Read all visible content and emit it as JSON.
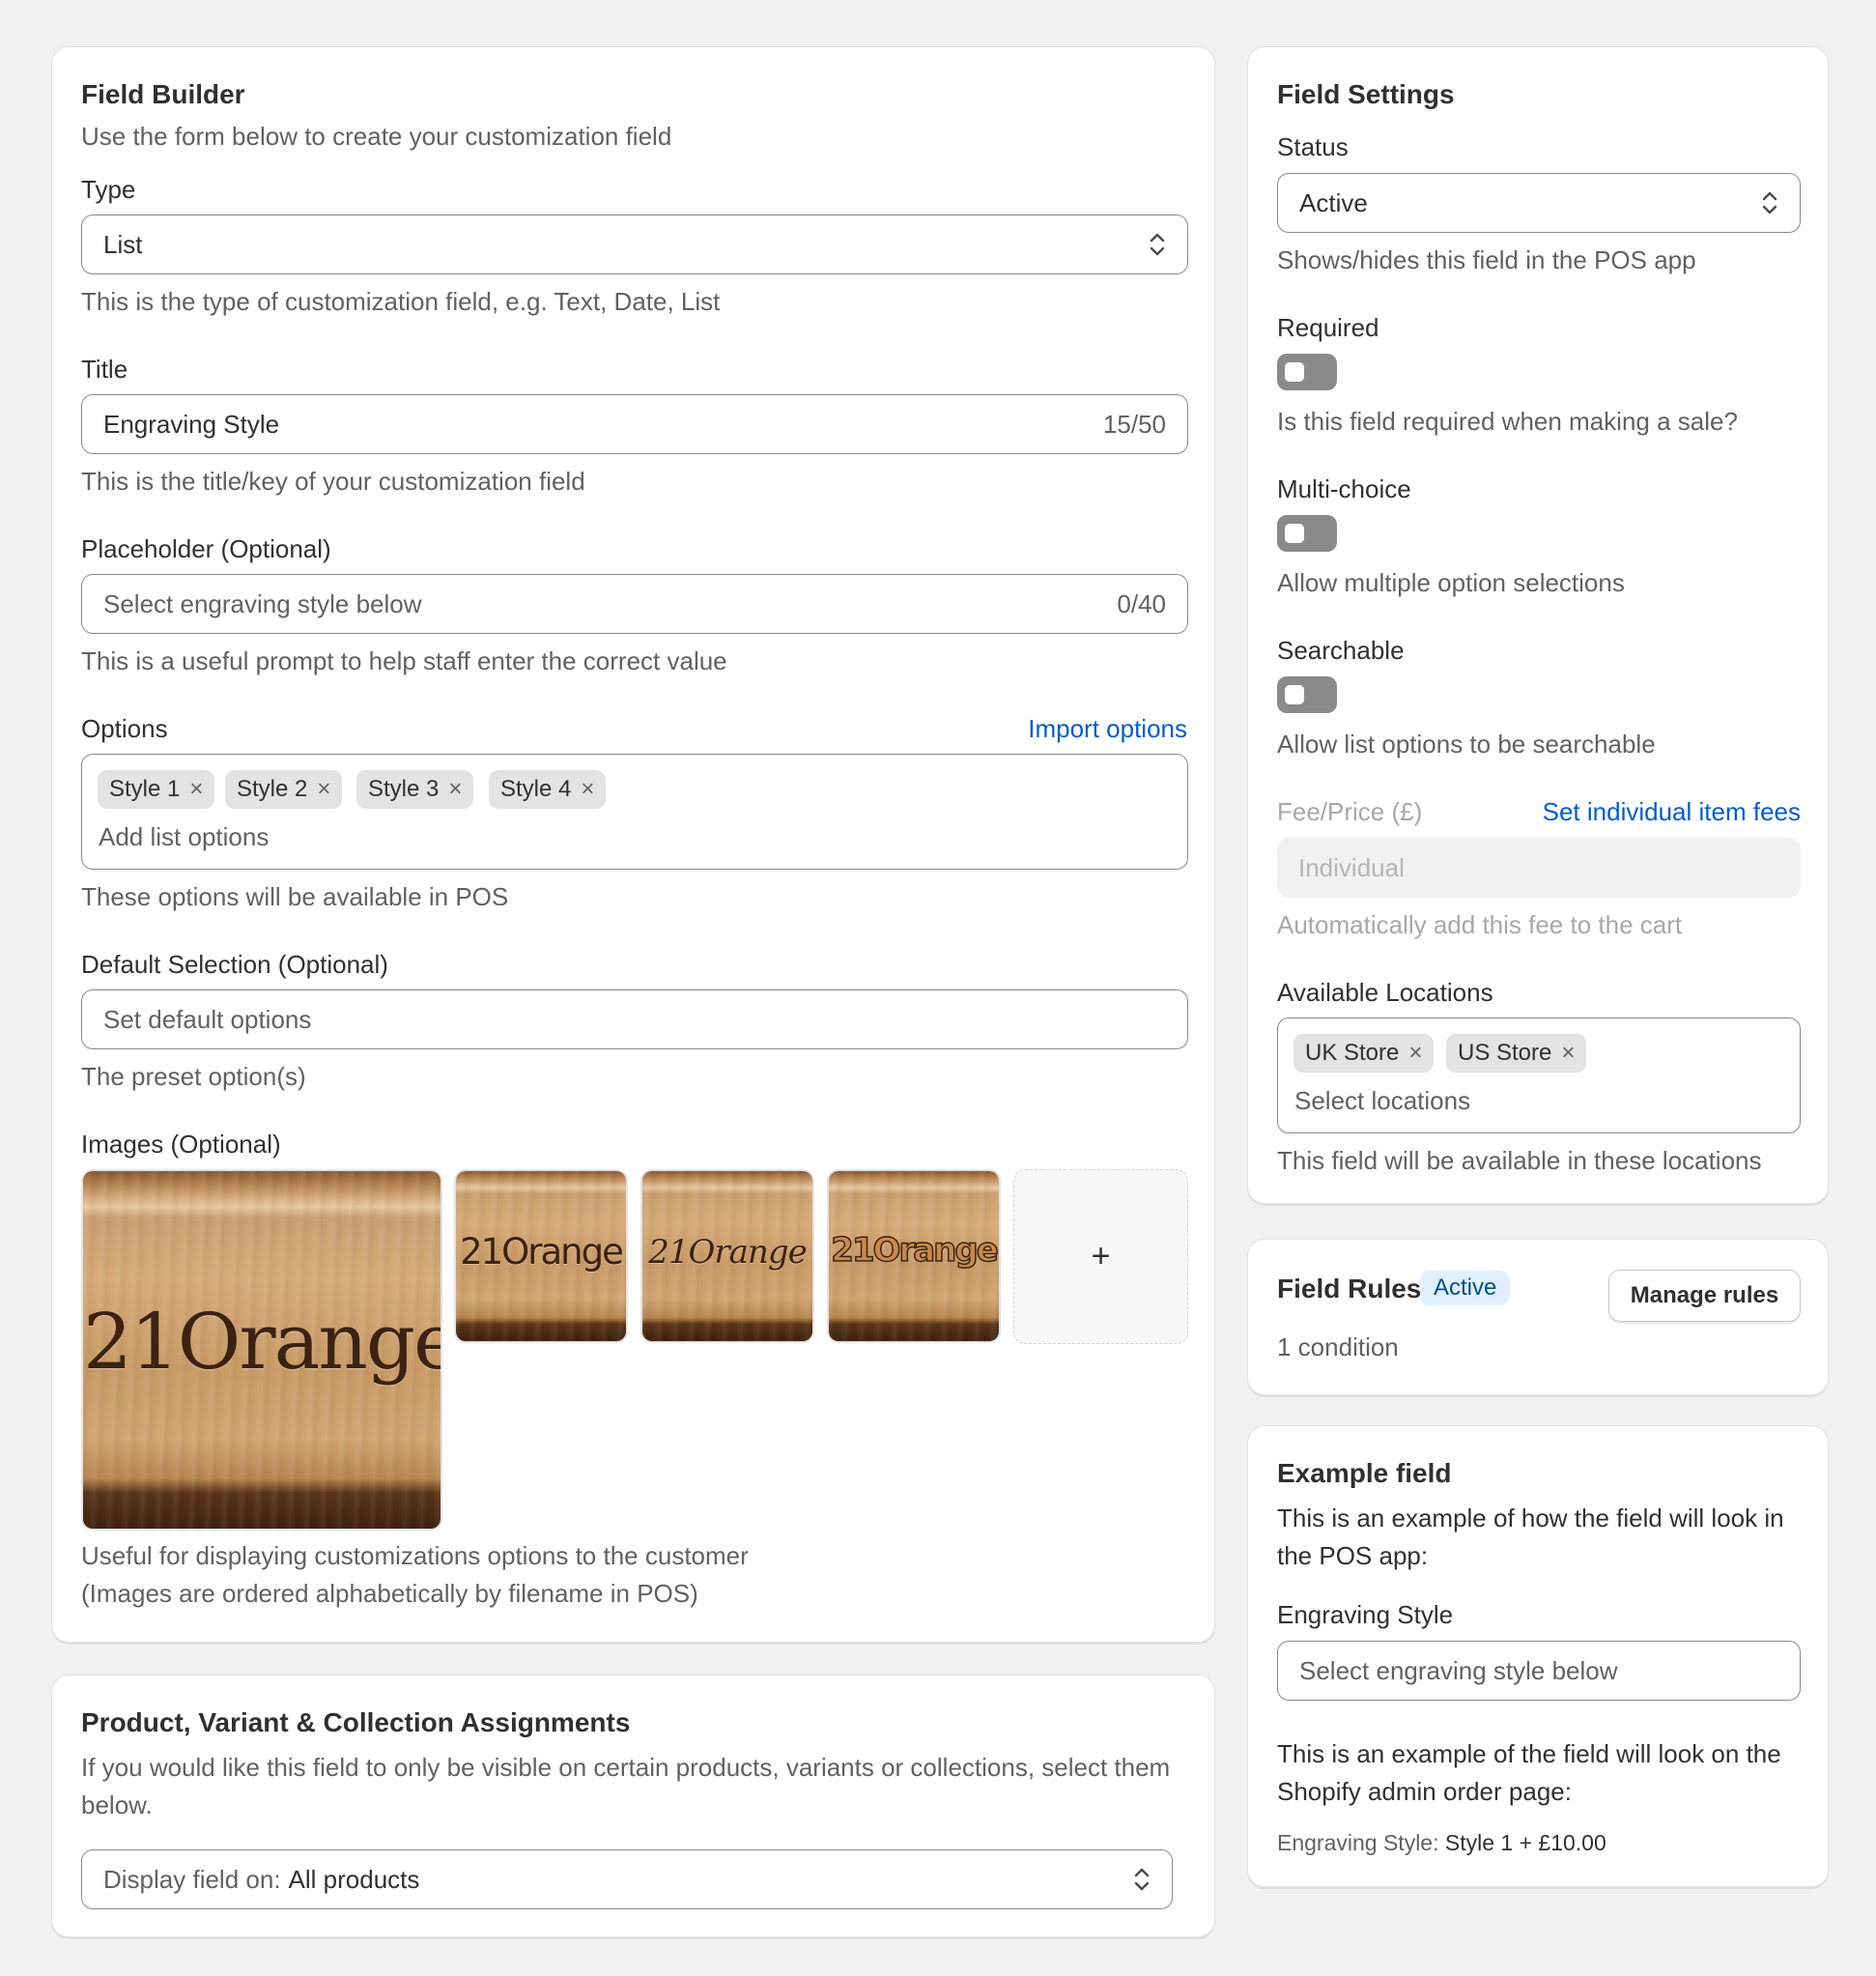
{
  "field_builder": {
    "title": "Field Builder",
    "subtitle": "Use the form below to create your customization field",
    "type": {
      "label": "Type",
      "value": "List",
      "help": "This is the type of customization field, e.g. Text, Date, List"
    },
    "title_field": {
      "label": "Title",
      "value": "Engraving Style",
      "counter": "15/50",
      "help": "This is the title/key of your customization field"
    },
    "placeholder": {
      "label": "Placeholder (Optional)",
      "placeholder": "Select engraving style below",
      "counter": "0/40",
      "help": "This is a useful prompt to help staff enter the correct value"
    },
    "options": {
      "label": "Options",
      "import_link": "Import options",
      "tags": [
        "Style 1",
        "Style 2",
        "Style 3",
        "Style 4"
      ],
      "remove_glyph": "×",
      "placeholder": "Add list options",
      "help": "These options will be available in POS"
    },
    "default_selection": {
      "label": "Default Selection (Optional)",
      "placeholder": "Set default options",
      "help": "The preset option(s)"
    },
    "images": {
      "label": "Images (Optional)",
      "thumbnails": [
        "21Orange",
        "21Orange",
        "21Orange",
        "21Orange"
      ],
      "add_glyph": "+",
      "help_line1": "Useful for displaying customizations options to the customer",
      "help_line2": "(Images are ordered alphabetically by filename in POS)"
    }
  },
  "assignments": {
    "title": "Product, Variant & Collection Assignments",
    "description": "If you would like this field to only be visible on certain products, variants or collections, select them below.",
    "display_prefix": "Display field on:",
    "display_value": "All products"
  },
  "field_settings": {
    "title": "Field Settings",
    "status": {
      "label": "Status",
      "value": "Active",
      "help": "Shows/hides this field in the POS app"
    },
    "required": {
      "label": "Required",
      "on": false,
      "help": "Is this field required when making a sale?"
    },
    "multi_choice": {
      "label": "Multi-choice",
      "on": false,
      "help": "Allow multiple option selections"
    },
    "searchable": {
      "label": "Searchable",
      "on": false,
      "help": "Allow list options to be searchable"
    },
    "fee": {
      "label": "Fee/Price (£)",
      "link": "Set individual item fees",
      "value": "Individual",
      "help": "Automatically add this fee to the cart"
    },
    "locations": {
      "label": "Available Locations",
      "tags": [
        "UK Store",
        "US Store"
      ],
      "placeholder": "Select locations",
      "help": "This field will be available in these locations"
    }
  },
  "field_rules": {
    "title": "Field Rules",
    "badge": "Active",
    "button": "Manage rules",
    "conditions": "1 condition"
  },
  "example": {
    "title": "Example field",
    "pos_intro": "This is an example of how the field will look in the POS app:",
    "field_label": "Engraving Style",
    "field_placeholder": "Select engraving style below",
    "admin_intro": "This is an example of the field will look on the Shopify admin order page:",
    "admin_key": "Engraving Style:",
    "admin_value": "Style 1 + £10.00"
  },
  "colors": {
    "link": "#005bd3",
    "badge_bg": "#e0f0ff",
    "toggle_off": "#8a8a8a",
    "page_bg": "#f1f1f1"
  },
  "icons": {
    "select": "chevron-up-down-icon",
    "remove": "close-icon",
    "add": "plus-icon"
  }
}
